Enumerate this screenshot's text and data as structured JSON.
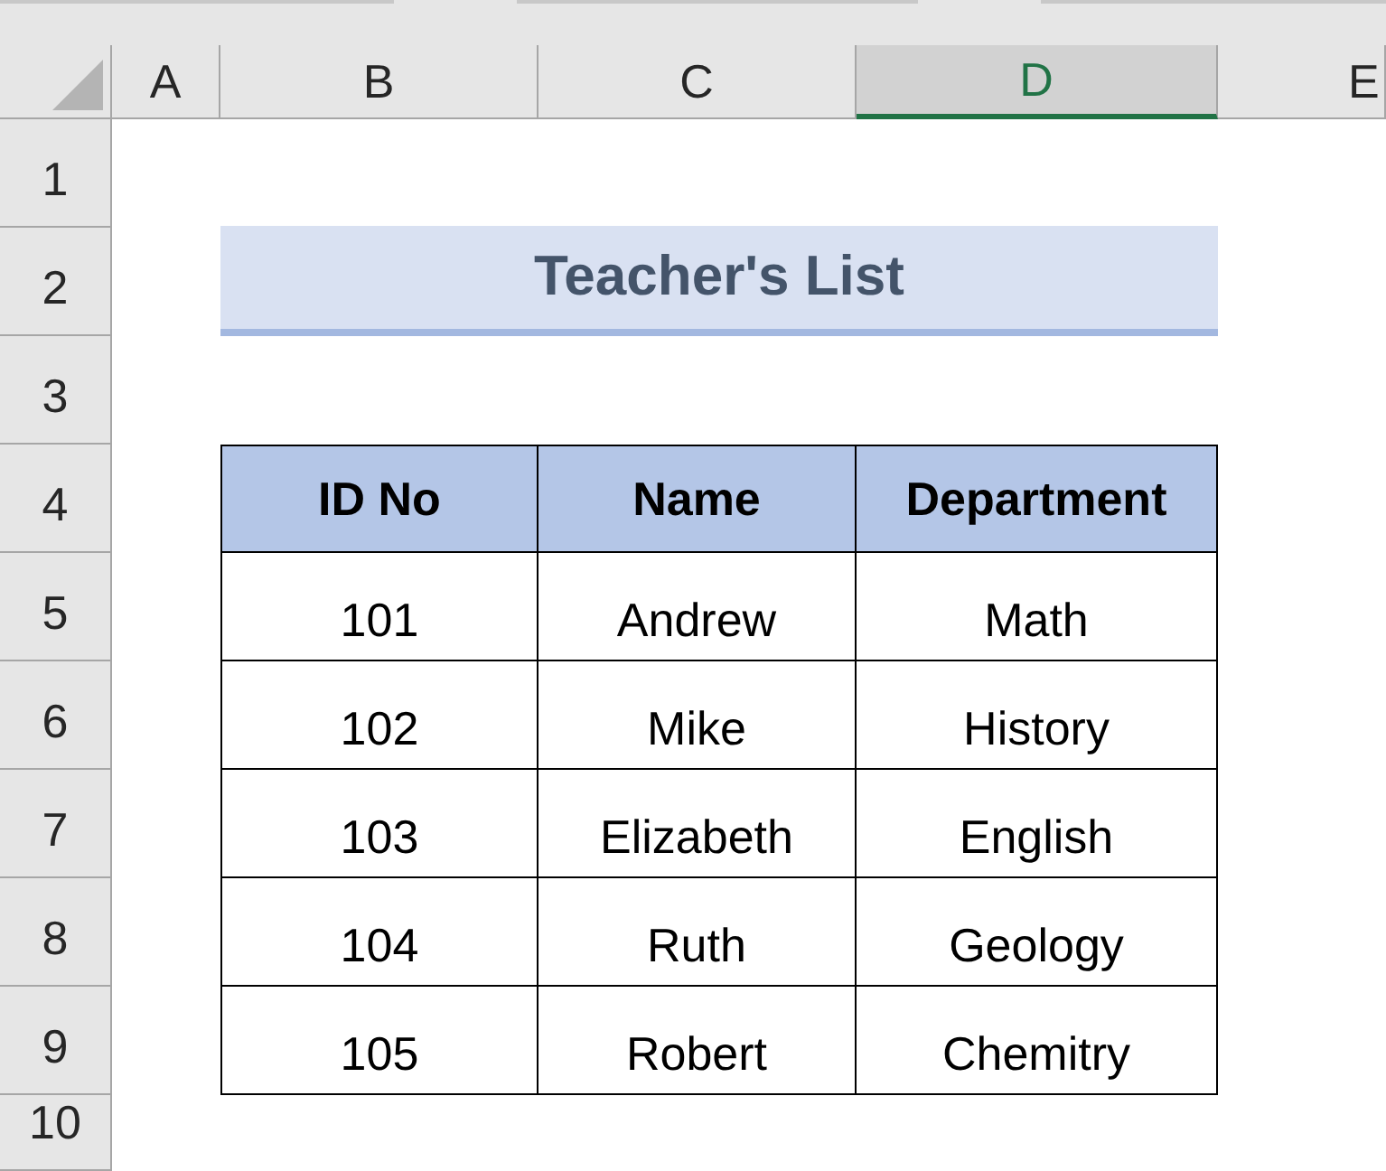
{
  "columns": [
    {
      "label": "A",
      "selected": false
    },
    {
      "label": "B",
      "selected": false
    },
    {
      "label": "C",
      "selected": false
    },
    {
      "label": "D",
      "selected": true
    },
    {
      "label": "E",
      "selected": false
    }
  ],
  "rows": [
    "1",
    "2",
    "3",
    "4",
    "5",
    "6",
    "7",
    "8",
    "9",
    "10"
  ],
  "title": "Teacher's List",
  "table": {
    "columns": [
      "ID No",
      "Name",
      "Department"
    ],
    "rows": [
      [
        "101",
        "Andrew",
        "Math"
      ],
      [
        "102",
        "Mike",
        "History"
      ],
      [
        "103",
        "Elizabeth",
        "English"
      ],
      [
        "104",
        "Ruth",
        "Geology"
      ],
      [
        "105",
        "Robert",
        "Chemitry"
      ]
    ]
  }
}
